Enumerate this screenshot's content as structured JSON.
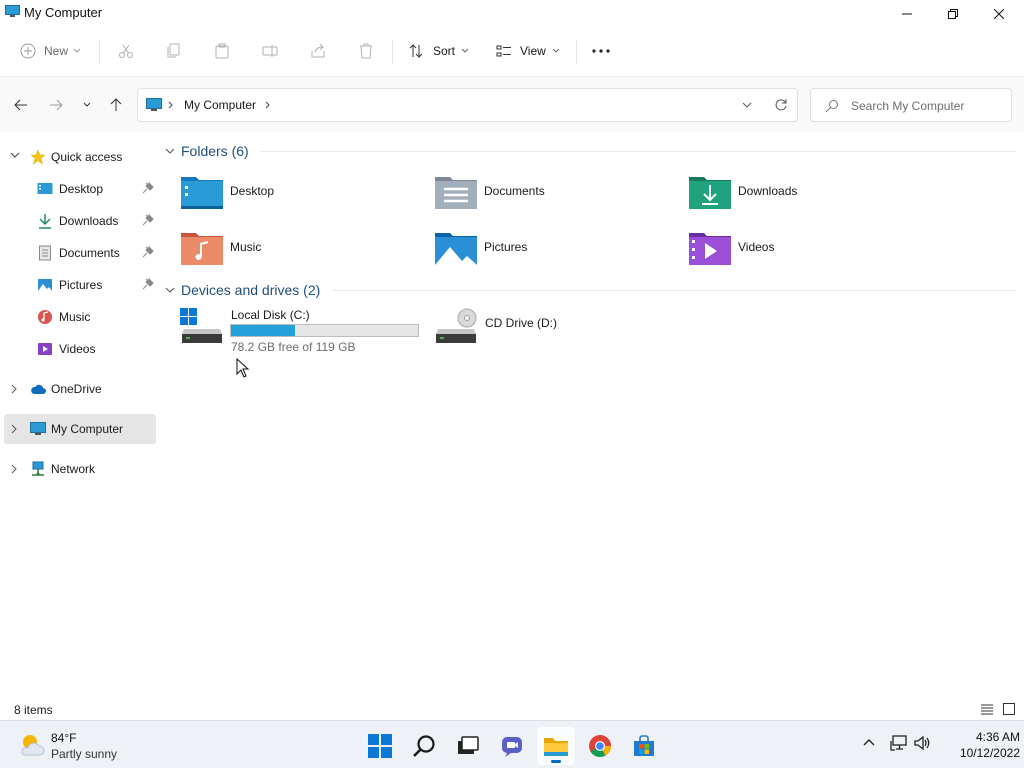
{
  "window": {
    "title": "My Computer"
  },
  "commandbar": {
    "new_label": "New",
    "sort_label": "Sort",
    "view_label": "View"
  },
  "address": {
    "crumb": "My Computer",
    "search_placeholder": "Search My Computer"
  },
  "sidebar": {
    "quick_access": "Quick access",
    "items": [
      {
        "label": "Desktop",
        "icon": "desktop-icon",
        "pinned": true
      },
      {
        "label": "Downloads",
        "icon": "downloads-icon",
        "pinned": true
      },
      {
        "label": "Documents",
        "icon": "documents-icon",
        "pinned": true
      },
      {
        "label": "Pictures",
        "icon": "pictures-icon",
        "pinned": true
      },
      {
        "label": "Music",
        "icon": "music-icon",
        "pinned": false
      },
      {
        "label": "Videos",
        "icon": "videos-icon",
        "pinned": false
      }
    ],
    "onedrive": "OneDrive",
    "my_computer": "My Computer",
    "network": "Network"
  },
  "content": {
    "folders_header": "Folders (6)",
    "folders": [
      {
        "name": "Desktop",
        "icon": "desktop-folder-icon"
      },
      {
        "name": "Documents",
        "icon": "documents-folder-icon"
      },
      {
        "name": "Downloads",
        "icon": "downloads-folder-icon"
      },
      {
        "name": "Music",
        "icon": "music-folder-icon"
      },
      {
        "name": "Pictures",
        "icon": "pictures-folder-icon"
      },
      {
        "name": "Videos",
        "icon": "videos-folder-icon"
      }
    ],
    "drives_header": "Devices and drives (2)",
    "drives": [
      {
        "name": "Local Disk (C:)",
        "free_text": "78.2 GB free of 119 GB",
        "used_fraction": 0.343
      },
      {
        "name": "CD Drive (D:)"
      }
    ]
  },
  "status": {
    "count": "8 items"
  },
  "taskbar": {
    "weather_temp": "84°F",
    "weather_cond": "Partly sunny",
    "time": "4:36 AM",
    "date": "10/12/2022"
  },
  "colors": {
    "accent": "#0067c0",
    "drive_fill": "#26a0da",
    "group_header": "#1f4e79"
  }
}
